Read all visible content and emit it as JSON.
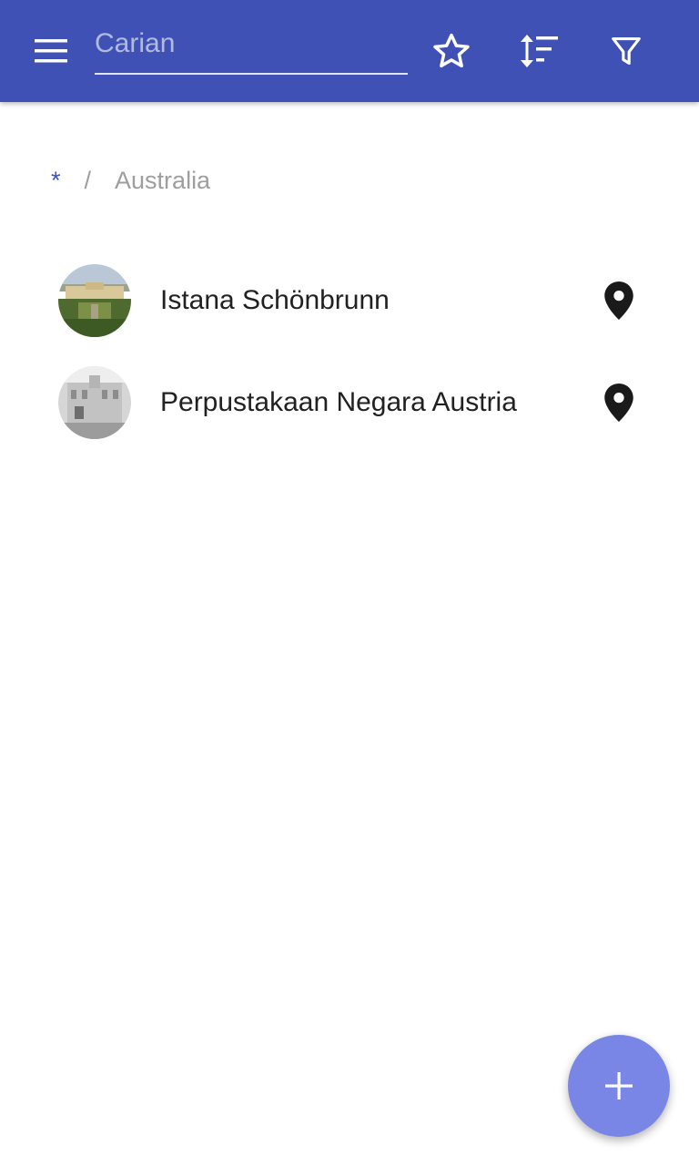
{
  "appbar": {
    "color": "#3f51b5",
    "menu_icon": "hamburger-menu-icon",
    "search": {
      "placeholder": "Carian",
      "value": ""
    },
    "actions": [
      {
        "icon": "star-outline-icon"
      },
      {
        "icon": "sort-icon"
      },
      {
        "icon": "filter-icon"
      }
    ]
  },
  "breadcrumb": {
    "root": "*",
    "separator": "/",
    "current": "Australia"
  },
  "items": [
    {
      "title": "Istana Schönbrunn",
      "avatar": "palace-photo",
      "action_icon": "map-pin-icon"
    },
    {
      "title": "Perpustakaan Negara Austria",
      "avatar": "library-photo",
      "action_icon": "map-pin-icon"
    }
  ],
  "fab": {
    "icon": "plus-icon",
    "color": "#7986e6"
  }
}
